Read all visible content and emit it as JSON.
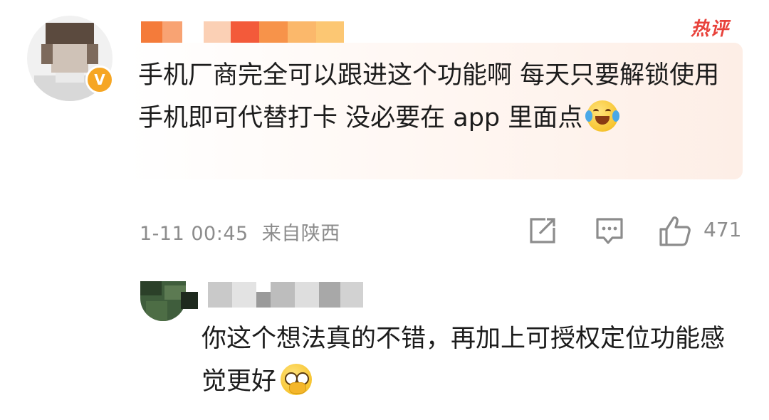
{
  "comment": {
    "hot_label": "热评",
    "text": "手机厂商完全可以跟进这个功能啊 每天只要解锁使用手机即可代替打卡 没必要在 app 里面点",
    "emoji": "crying-laughing-emoji",
    "timestamp": "1-11 00:45",
    "location": "来自陕西",
    "likes": "471",
    "verified_badge": "V",
    "colors": {
      "hot": "#e8423b",
      "badge": "#f6a623",
      "meta": "#8c8c8c"
    }
  },
  "reply": {
    "text": "你这个想法真的不错，再加上可授权定位功能感觉更好",
    "emoji": "glasses-face-emoji"
  }
}
